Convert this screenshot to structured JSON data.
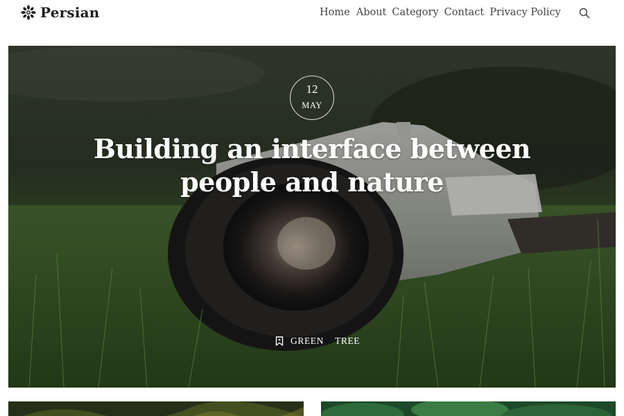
{
  "site": {
    "brand": "Persian",
    "logo_icon": "mandala-flower-icon"
  },
  "nav": {
    "items": [
      {
        "label": "Home"
      },
      {
        "label": "About"
      },
      {
        "label": "Category"
      },
      {
        "label": "Contact"
      },
      {
        "label": "Privacy Policy"
      }
    ],
    "search_icon": "search-icon"
  },
  "hero": {
    "date_day": "12",
    "date_month": "MAY",
    "title": "Building an interface between people and nature",
    "tag_icon": "bookmark-icon",
    "tags": [
      "GREEN",
      "TREE"
    ],
    "image_subject": "camera-in-grass"
  },
  "cards": [
    {
      "image_subject": "dark-green-leaves"
    },
    {
      "image_subject": "bright-green-leaves"
    }
  ],
  "colors": {
    "text_dark": "#1f1f1f",
    "nav_text": "#444444",
    "hero_text": "#ffffff"
  }
}
